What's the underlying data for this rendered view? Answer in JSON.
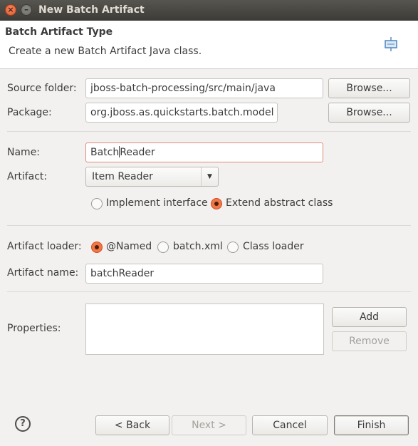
{
  "window": {
    "title": "New Batch Artifact",
    "close_glyph": "×",
    "minimize_glyph": "–"
  },
  "banner": {
    "title": "Batch Artifact Type",
    "description": "Create a new Batch Artifact Java class."
  },
  "source_folder": {
    "label": "Source folder:",
    "value": "jboss-batch-processing/src/main/java",
    "browse_label": "Browse..."
  },
  "package": {
    "label": "Package:",
    "value": "org.jboss.as.quickstarts.batch.model",
    "browse_label": "Browse..."
  },
  "name": {
    "label": "Name:",
    "value_before_caret": "Batch",
    "value_after_caret": "Reader"
  },
  "artifact": {
    "label": "Artifact:",
    "selected": "Item Reader",
    "arrow": "▼"
  },
  "impl_options": [
    {
      "label": "Implement interface",
      "checked": false
    },
    {
      "label": "Extend abstract class",
      "checked": true
    }
  ],
  "loader": {
    "label": "Artifact loader:",
    "options": [
      {
        "label": "@Named",
        "checked": true
      },
      {
        "label": "batch.xml",
        "checked": false
      },
      {
        "label": "Class loader",
        "checked": false
      }
    ]
  },
  "artifact_name": {
    "label": "Artifact name:",
    "value": "batchReader"
  },
  "properties": {
    "label": "Properties:",
    "add_label": "Add",
    "remove_label": "Remove"
  },
  "footer": {
    "help_glyph": "?",
    "back_label": "< Back",
    "next_label": "Next >",
    "cancel_label": "Cancel",
    "finish_label": "Finish"
  },
  "colors": {
    "accent": "#f07746",
    "titlebar": "#3c3b37",
    "background": "#f2f1f0"
  }
}
